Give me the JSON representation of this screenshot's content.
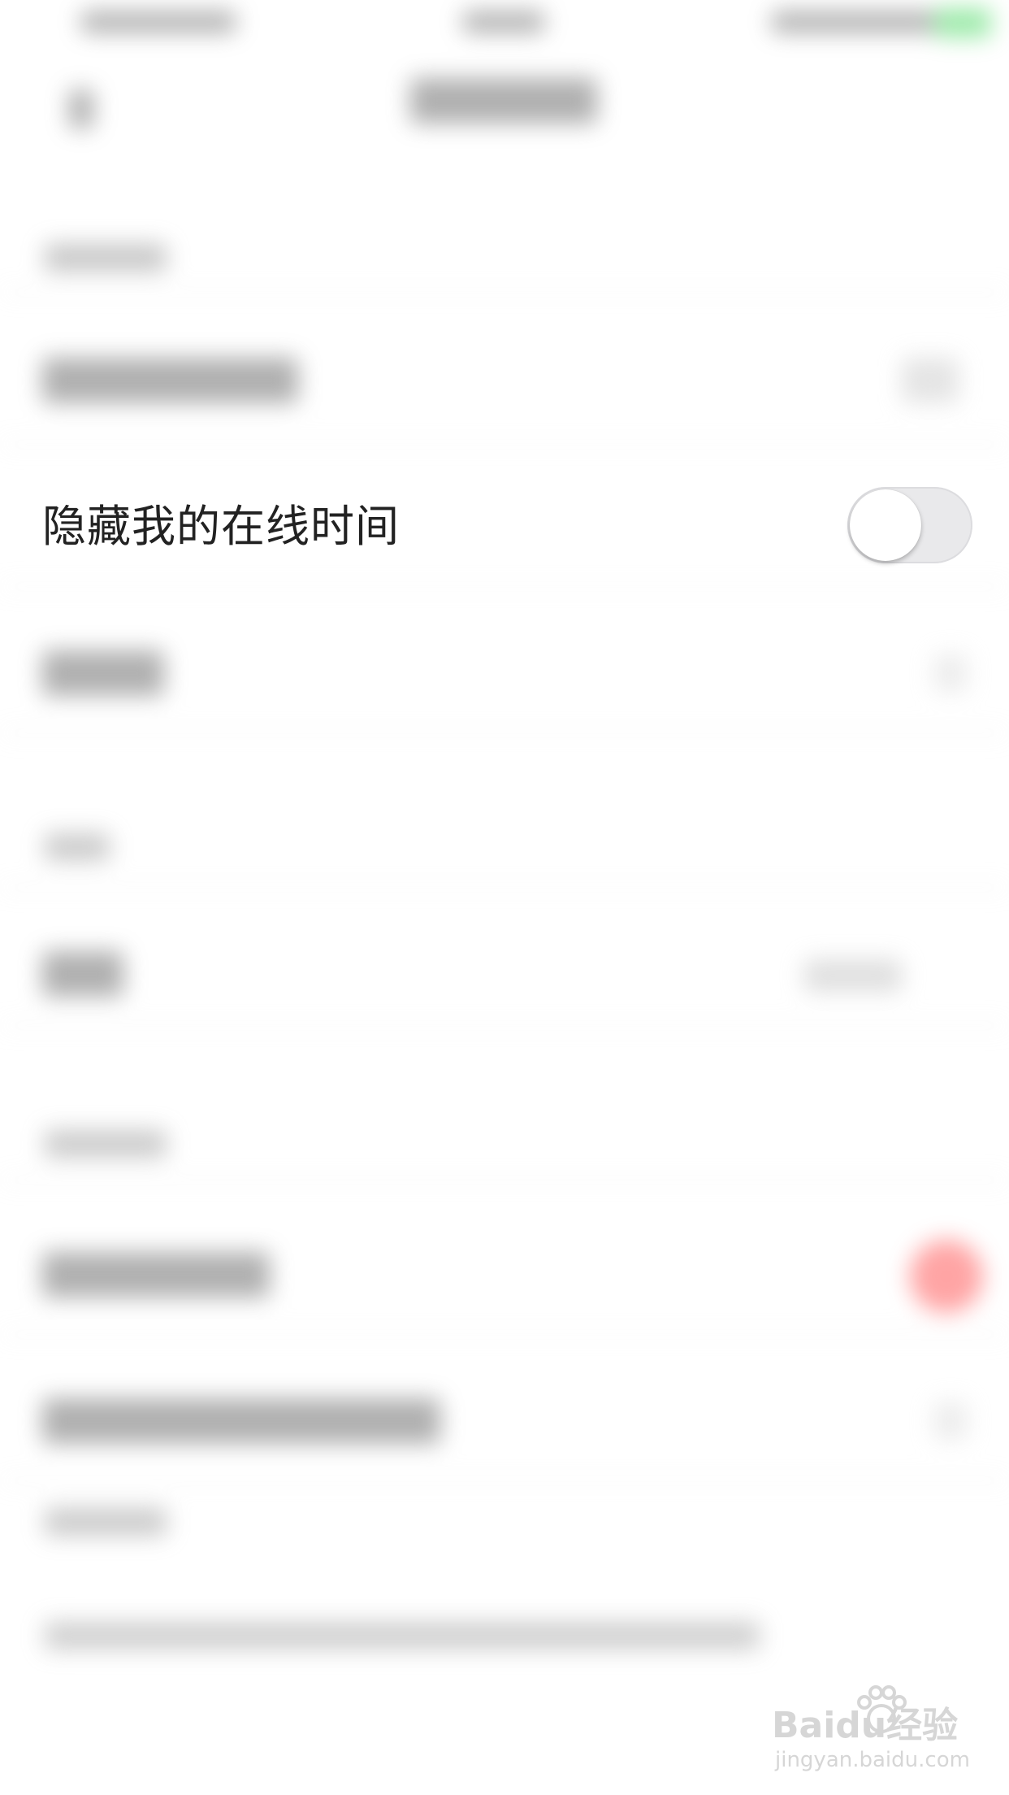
{
  "settings": {
    "hide_online_time": {
      "label": "隐藏我的在线时间",
      "toggle_on": false
    }
  },
  "watermark": {
    "brand": "Baidu经验",
    "url": "jingyan.baidu.com"
  },
  "colors": {
    "background": "#ffffff",
    "toggle_off_track": "#e9e9eb",
    "label_text": "#222222",
    "blurred_badge_red": "#ff5a5a",
    "blurred_status_green": "#4cd964"
  }
}
